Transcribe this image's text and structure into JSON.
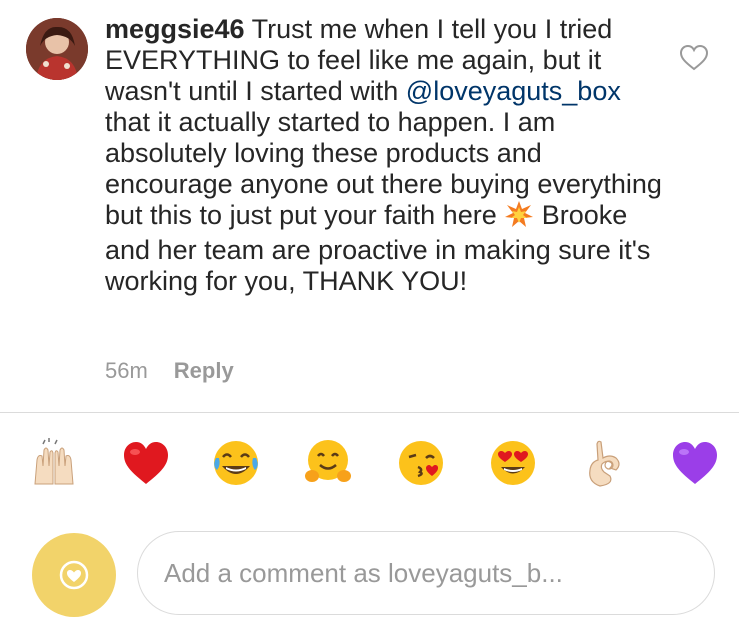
{
  "comment": {
    "username": "meggsie46",
    "text_part1": " Trust me when I tell you I tried EVERYTHING  to feel like me again, but it wasn't until I started with ",
    "mention": "@loveyaguts_box",
    "text_part2": " that it actually started to happen. I am absolutely loving these products and encourage anyone out there buying everything but this to just put your faith here ",
    "text_part3": " Brooke and her team are proactive in making sure it's working for you, THANK YOU!",
    "inline_emoji_icon": "sparkle-burst-icon",
    "time": "56m",
    "reply_label": "Reply",
    "like_icon": "heart-outline-icon"
  },
  "emoji_bar": {
    "items": [
      {
        "icon": "raised-hands-icon"
      },
      {
        "icon": "red-heart-icon"
      },
      {
        "icon": "tears-of-joy-icon"
      },
      {
        "icon": "hugging-face-icon"
      },
      {
        "icon": "face-blowing-kiss-icon"
      },
      {
        "icon": "heart-eyes-icon"
      },
      {
        "icon": "ok-hand-icon"
      },
      {
        "icon": "purple-heart-icon"
      }
    ]
  },
  "composer": {
    "avatar_icon": "heart-avatar-icon",
    "placeholder": "Add a comment as loveyaguts_b..."
  },
  "colors": {
    "text": "#262626",
    "muted": "#999999",
    "mention": "#003569",
    "divider": "#dbdbdb",
    "avatar_yellow": "#f2d36a"
  }
}
